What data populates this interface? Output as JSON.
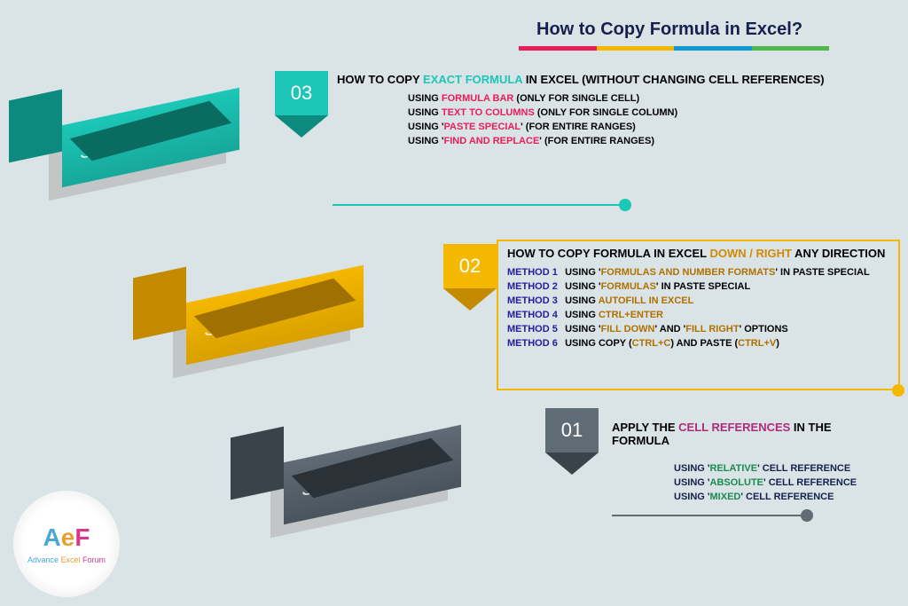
{
  "title": "How to Copy Formula in Excel?",
  "rainbow": [
    "#e81e5b",
    "#f5b800",
    "#1498d4",
    "#4fb84a"
  ],
  "step3": {
    "number": "03",
    "label": "STEP",
    "color": "#1cc7b7",
    "colorDark": "#0d8a7e",
    "heading_pre": "HOW TO COPY ",
    "heading_hl": "EXACT FORMULA",
    "heading_post": " IN EXCEL (WITHOUT CHANGING CELL REFERENCES)",
    "lines": [
      {
        "pre": "USING ",
        "hl": "FORMULA BAR",
        "post": " (ONLY FOR SINGLE CELL)",
        "hlc": "#e81e5b"
      },
      {
        "pre": "USING ",
        "hl": "TEXT TO COLUMNS",
        "post": " (ONLY FOR SINGLE COLUMN)",
        "hlc": "#e81e5b"
      },
      {
        "pre": "USING '",
        "hl": "PASTE SPECIAL",
        "post": "' (FOR ENTIRE RANGES)",
        "hlc": "#e81e5b"
      },
      {
        "pre": "USING '",
        "hl": "FIND AND REPLACE",
        "post": "' (FOR ENTIRE RANGES)",
        "hlc": "#e81e5b"
      }
    ]
  },
  "step2": {
    "number": "02",
    "label": "STEP",
    "color": "#f5b800",
    "colorDark": "#c48a00",
    "heading_pre": "HOW TO COPY FORMULA IN EXCEL ",
    "heading_hl": "DOWN / RIGHT",
    "heading_post": " ANY DIRECTION",
    "methods": [
      {
        "m": "METHOD 1",
        "pre": "USING '",
        "hl": "FORMULAS AND NUMBER FORMATS",
        "post": "' IN PASTE SPECIAL"
      },
      {
        "m": "METHOD 2",
        "pre": "USING '",
        "hl": "FORMULAS",
        "post": "' IN PASTE SPECIAL"
      },
      {
        "m": "METHOD 3",
        "pre": "USING ",
        "hl": "AUTOFILL IN EXCEL",
        "post": ""
      },
      {
        "m": "METHOD 4",
        "pre": "USING ",
        "hl": "CTRL+ENTER",
        "post": ""
      },
      {
        "m": "METHOD 5",
        "pre": "USING '",
        "hl": "FILL DOWN",
        "post": "' AND 'FILL RIGHT' OPTIONS",
        "hl2": "FILL RIGHT"
      },
      {
        "m": "METHOD 6",
        "pre": "USING COPY (",
        "hl": "CTRL+C",
        "post": ") AND PASTE (CTRL+V)",
        "hl2": "CTRL+V"
      }
    ]
  },
  "step1": {
    "number": "01",
    "label": "STEP",
    "color": "#5f6b75",
    "colorDark": "#3a434a",
    "heading_pre": "APPLY THE ",
    "heading_hl": "CELL REFERENCES",
    "heading_post": " IN THE FORMULA",
    "lines": [
      {
        "pre": "USING '",
        "hl": "RELATIVE",
        "post": "' CELL REFERENCE",
        "hlc": "#1a8a50"
      },
      {
        "pre": "USING '",
        "hl": "ABSOLUTE",
        "post": "' CELL REFERENCE",
        "hlc": "#1a8a50"
      },
      {
        "pre": "USING '",
        "hl": "MIXED",
        "post": "' CELL REFERENCE",
        "hlc": "#1a8a50"
      }
    ]
  },
  "logo": {
    "a": "A",
    "e": "e",
    "f": "F",
    "text_a": "Advance",
    "text_e": "Excel",
    "text_f": "Forum"
  }
}
